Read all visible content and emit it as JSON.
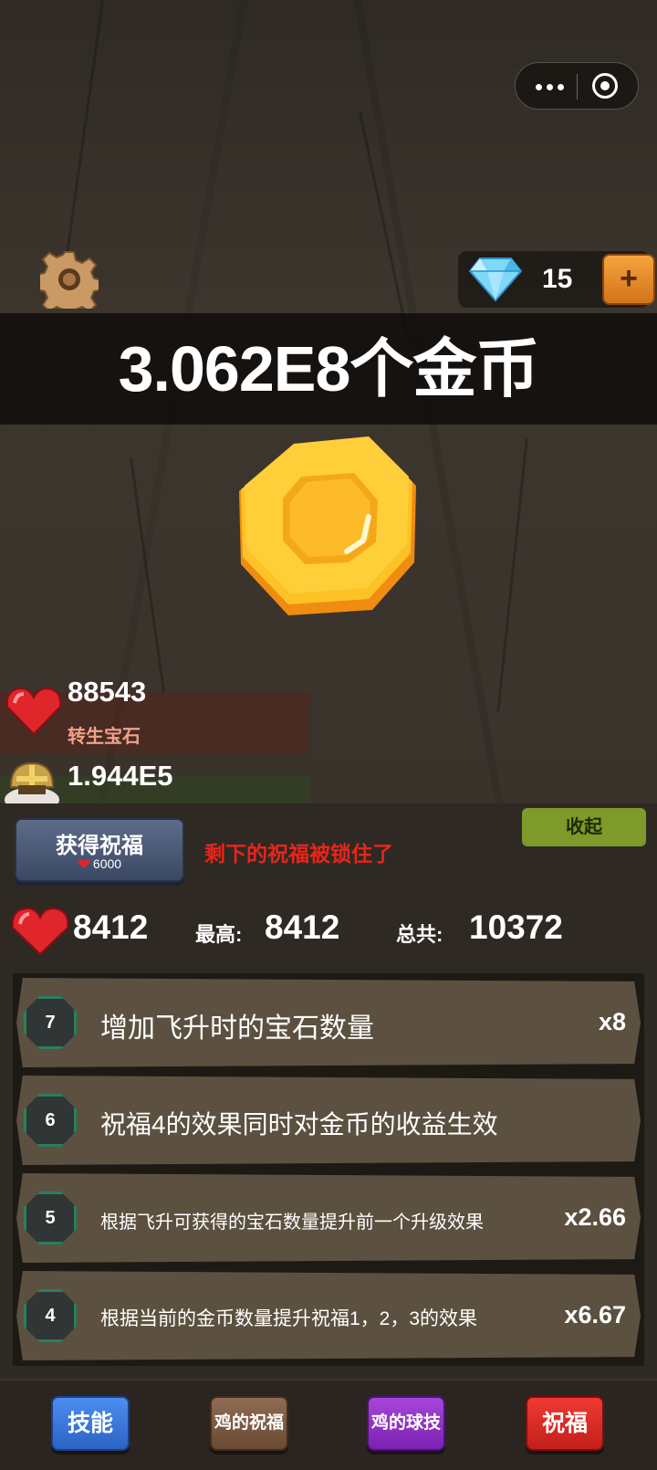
{
  "top": {
    "gem_count": "15",
    "plus_label": "+"
  },
  "banner": {
    "coins_text": "3.062E8个金币"
  },
  "stats": {
    "rebirth_gems_value": "88543",
    "rebirth_gems_label": "转生宝石",
    "knight_value": "1.944E5"
  },
  "panel": {
    "collapse_label": "收起",
    "get_blessing_title": "获得祝福",
    "get_blessing_cost": "6000",
    "locked_message": "剩下的祝福被锁住了",
    "current_gems": "8412",
    "best_label": "最高:",
    "best_value": "8412",
    "total_label": "总共:",
    "total_value": "10372"
  },
  "blessings": [
    {
      "level": "7",
      "text": "增加飞升时的宝石数量",
      "multiplier": "x8"
    },
    {
      "level": "6",
      "text": "祝福4的效果同时对金币的收益生效",
      "multiplier": ""
    },
    {
      "level": "5",
      "text": "根据飞升可获得的宝石数量提升前一个升级效果",
      "multiplier": "x2.66"
    },
    {
      "level": "4",
      "text": "根据当前的金币数量提升祝福1，2，3的效果",
      "multiplier": "x6.67"
    }
  ],
  "nav": {
    "skills": "技能",
    "chicken_blessing": "鸡的祝福",
    "chicken_ball": "鸡的球技",
    "blessing": "祝福"
  },
  "colors": {
    "accent_red": "#e8251b",
    "collapse_green": "#7d9a2a",
    "badge_ring": "#2a7f5c"
  }
}
